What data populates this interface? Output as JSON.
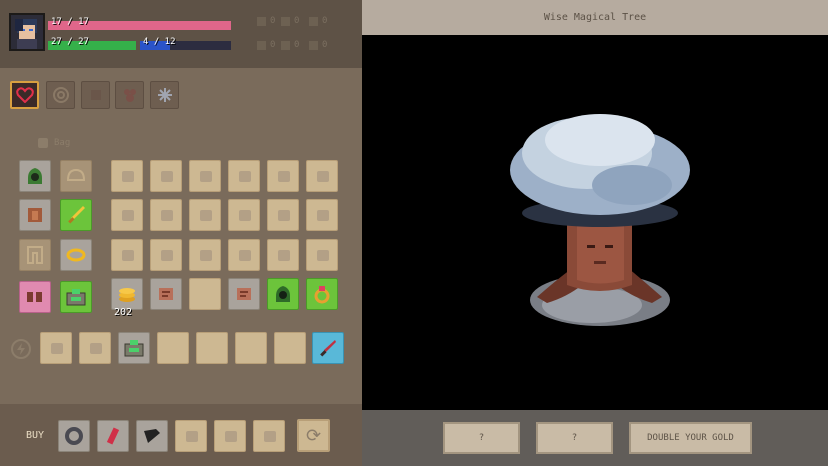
{
  "player": {
    "hp_text": "17 / 17",
    "hp_fraction": 1.0,
    "mana_text": "27 / 27",
    "mana_fraction": 1.0,
    "xp_text": "4 / 12",
    "xp_fraction": 0.33
  },
  "stats": [
    "0",
    "0",
    "0",
    "0",
    "0",
    "0"
  ],
  "bag": {
    "label": "Bag"
  },
  "grid": {
    "coin_quantity": "202"
  },
  "shop": {
    "buy_label": "BUY"
  },
  "npc": {
    "name": "Wise Magical Tree"
  },
  "dialog": {
    "option_1": "?",
    "option_2": "?",
    "option_3": "DOUBLE YOUR GOLD"
  },
  "colors": {
    "hp": "#e0668a",
    "mana": "#35b04a",
    "xp": "#2a53c8",
    "panel": "#7a6b5b"
  }
}
